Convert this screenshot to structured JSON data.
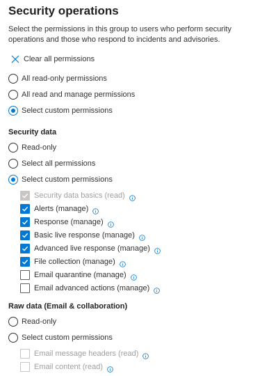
{
  "header": {
    "title": "Security operations",
    "description": "Select the permissions in this group to users who perform security operations and those who respond to incidents and advisories."
  },
  "clear_button": {
    "label": "Clear all permissions"
  },
  "top_options": [
    {
      "label": "All read-only permissions",
      "selected": false
    },
    {
      "label": "All read and manage permissions",
      "selected": false
    },
    {
      "label": "Select custom permissions",
      "selected": true
    }
  ],
  "security_data": {
    "heading": "Security data",
    "options": [
      {
        "label": "Read-only",
        "selected": false
      },
      {
        "label": "Select all permissions",
        "selected": false
      },
      {
        "label": "Select custom permissions",
        "selected": true
      }
    ],
    "permissions": [
      {
        "label": "Security data basics (read)",
        "state": "checked-disabled"
      },
      {
        "label": "Alerts (manage)",
        "state": "checked"
      },
      {
        "label": "Response (manage)",
        "state": "checked"
      },
      {
        "label": "Basic live response (manage)",
        "state": "checked"
      },
      {
        "label": "Advanced live response (manage)",
        "state": "checked"
      },
      {
        "label": "File collection (manage)",
        "state": "checked"
      },
      {
        "label": "Email quarantine (manage)",
        "state": "unchecked"
      },
      {
        "label": "Email advanced actions (manage)",
        "state": "unchecked"
      }
    ]
  },
  "raw_data": {
    "heading": "Raw data (Email & collaboration)",
    "options": [
      {
        "label": "Read-only",
        "selected": false
      },
      {
        "label": "Select custom permissions",
        "selected": false
      }
    ],
    "permissions": [
      {
        "label": "Email message headers (read)",
        "state": "disabled"
      },
      {
        "label": "Email content (read)",
        "state": "disabled"
      }
    ]
  },
  "colors": {
    "accent": "#0078d4",
    "text": "#323130",
    "disabled": "#c8c6c4"
  },
  "icons": {
    "clear": "close-icon",
    "info": "info-icon",
    "check": "checkmark-icon"
  }
}
